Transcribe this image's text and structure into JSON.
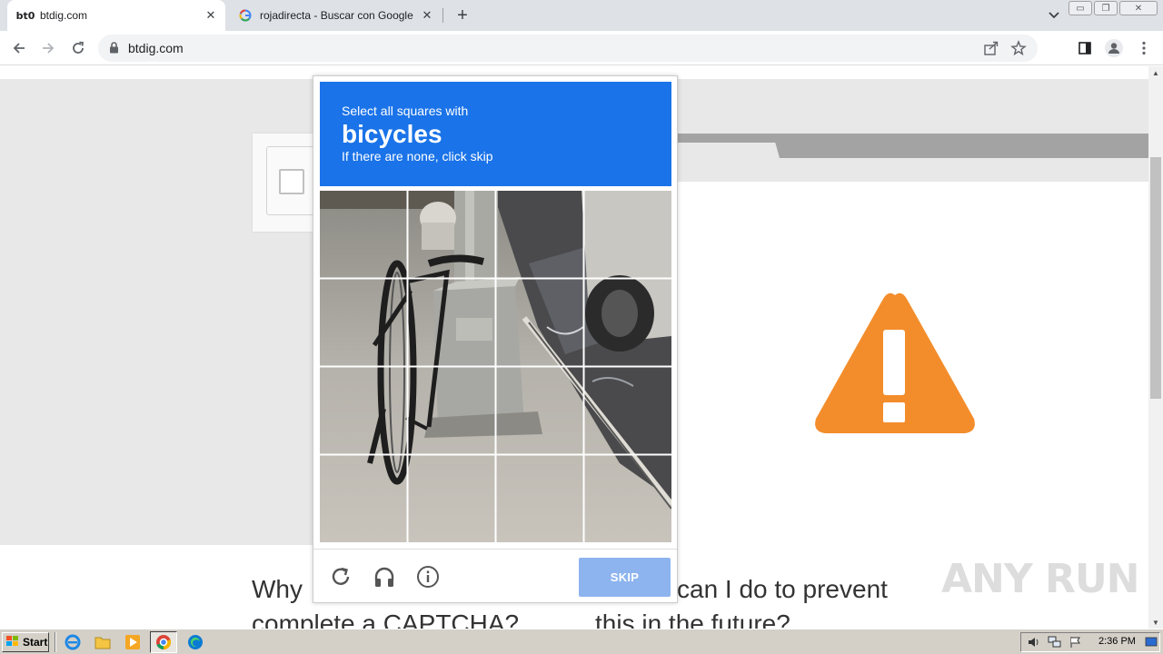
{
  "browser": {
    "tabs": [
      {
        "title": "btdig.com",
        "favicon": "bt0",
        "active": true
      },
      {
        "title": "rojadirecta - Buscar con Google",
        "favicon": "G",
        "active": false
      }
    ],
    "url": "btdig.com"
  },
  "captcha": {
    "prompt_line1": "Select all squares with",
    "target_word": "bicycles",
    "prompt_line3": "If there are none, click skip",
    "skip_label": "SKIP",
    "tiles": [
      1,
      2,
      3,
      4,
      5,
      6,
      7,
      8,
      9,
      10,
      11,
      12,
      13,
      14,
      15,
      16
    ],
    "footer_icons": [
      "reload-icon",
      "audio-icon",
      "info-icon"
    ]
  },
  "page": {
    "left_heading": "Why do I have to complete a CAPTCHA?",
    "left_heading_visible_line1": "Why",
    "left_heading_visible_line2": "complete a CAPTCHA?",
    "right_heading_visible_line1": "can I do to prevent",
    "right_heading_visible_line2": "this in the future?"
  },
  "watermark": "ANY RUN",
  "taskbar": {
    "start_label": "Start",
    "clock": "2:36 PM"
  },
  "colors": {
    "captcha_blue": "#1a73e8",
    "skip_disabled": "#8db4ee",
    "warning_orange": "#f38d2b"
  }
}
